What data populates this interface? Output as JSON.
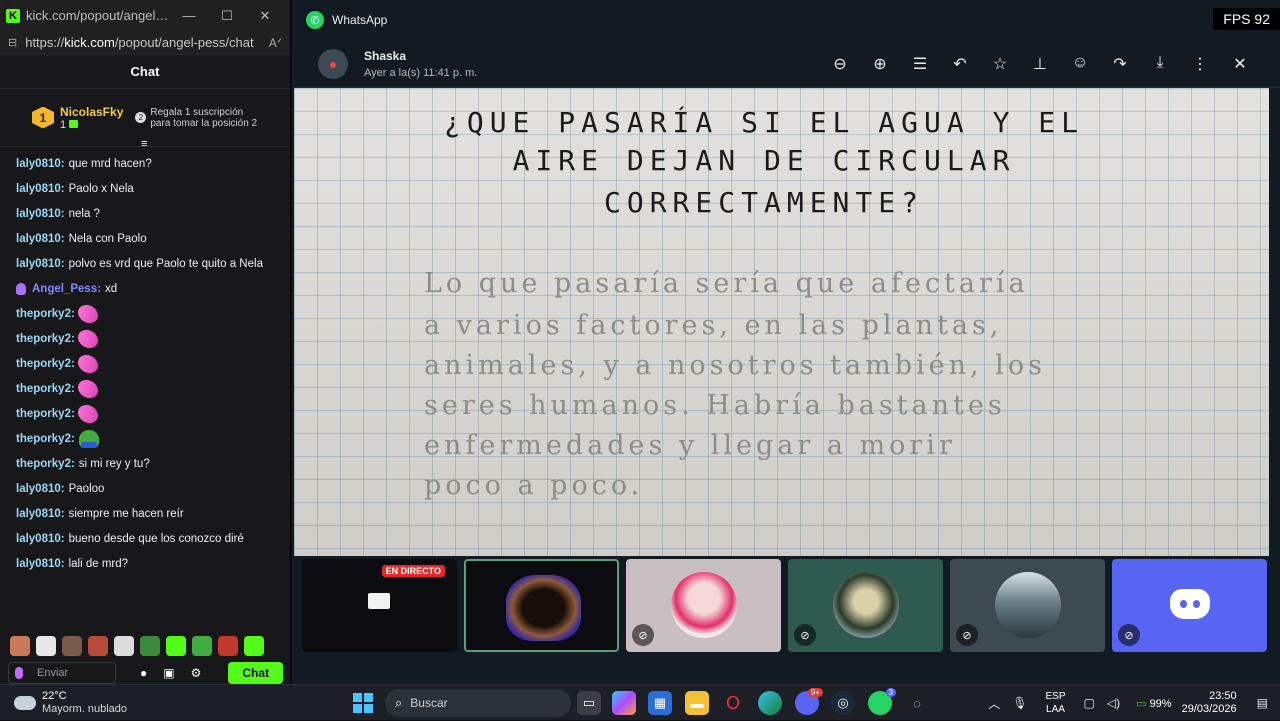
{
  "kick": {
    "window_title": "kick.com/popout/angel-pes...",
    "url_prefix": "https://",
    "url_domain": "kick.com",
    "url_path": "/popout/angel-pess/chat",
    "chat_title": "Chat",
    "pinned": {
      "rank": "1",
      "username": "NicolasFky",
      "subs": "1",
      "promo_rank": "2",
      "promo_text": "Regala 1 suscripción para tomar la posición 2"
    },
    "messages": [
      {
        "user": "laly0810:",
        "text": "que mrd hacen?",
        "type": "text"
      },
      {
        "user": "laly0810:",
        "text": "Paolo x Nela",
        "type": "text"
      },
      {
        "user": "laly0810:",
        "text": "nela ?",
        "type": "text"
      },
      {
        "user": "laly0810:",
        "text": "Nela con Paolo",
        "type": "text"
      },
      {
        "user": "laly0810:",
        "text": "polvo es vrd que Paolo te quito a Nela",
        "type": "text"
      },
      {
        "user": "Angel_Pess:",
        "text": "xd",
        "type": "mod"
      },
      {
        "user": "theporky2:",
        "text": "",
        "type": "feather"
      },
      {
        "user": "theporky2:",
        "text": "",
        "type": "feather"
      },
      {
        "user": "theporky2:",
        "text": "",
        "type": "feather"
      },
      {
        "user": "theporky2:",
        "text": "",
        "type": "feather"
      },
      {
        "user": "theporky2:",
        "text": "",
        "type": "feather"
      },
      {
        "user": "theporky2:",
        "text": "",
        "type": "pepe"
      },
      {
        "user": "theporky2:",
        "text": "si mi rey y tu?",
        "type": "text"
      },
      {
        "user": "laly0810:",
        "text": "Paoloo",
        "type": "text"
      },
      {
        "user": "laly0810:",
        "text": "siempre me hacen reír",
        "type": "text"
      },
      {
        "user": "laly0810:",
        "text": "bueno desde que los conozco diré",
        "type": "text"
      },
      {
        "user": "laly0810:",
        "text": "lali de mrd?",
        "type": "text"
      }
    ],
    "input_placeholder": "Enviar",
    "send_label": "Chat"
  },
  "whatsapp": {
    "app_title": "WhatsApp",
    "fps": "FPS 92",
    "sender_name": "Shaska",
    "sender_time": "Ayer a la(s) 11:41 p. m.",
    "tools": [
      "zoom-out-icon",
      "zoom-in-icon",
      "caption-icon",
      "reply-icon",
      "star-icon",
      "pin-icon",
      "emoji-icon",
      "forward-icon",
      "download-icon",
      "more-icon",
      "close-icon"
    ],
    "photo": {
      "question_lines": [
        "¿QUE PASARÍA SI EL AGUA Y EL",
        "AIRE DEJAN DE CIRCULAR",
        "CORRECTAMENTE?"
      ],
      "answer_lines": [
        "Lo que pasaría sería que afectaría",
        "a varios factores, en las plantas,",
        "animales, y a nosotros también, los",
        "seres humanos. Habría bastantes",
        "enfermedades y llegar a morir",
        "poco a poco."
      ]
    },
    "thumbnails": [
      {
        "label": "EN DIRECTO",
        "kind": "stream"
      },
      {
        "label": "",
        "kind": "selected"
      },
      {
        "label": "",
        "kind": "avatar-pink"
      },
      {
        "label": "",
        "kind": "avatar-group"
      },
      {
        "label": "",
        "kind": "avatar-lake"
      },
      {
        "label": "",
        "kind": "discord"
      }
    ]
  },
  "taskbar": {
    "temp": "22°C",
    "condition": "Mayorm. nublado",
    "search_placeholder": "Buscar",
    "discord_badge": "9+",
    "whatsapp_badge": "3",
    "lang_top": "ESP",
    "lang_bottom": "LAA",
    "battery": "99%",
    "time": "23:50",
    "date": "29/03/2026"
  }
}
